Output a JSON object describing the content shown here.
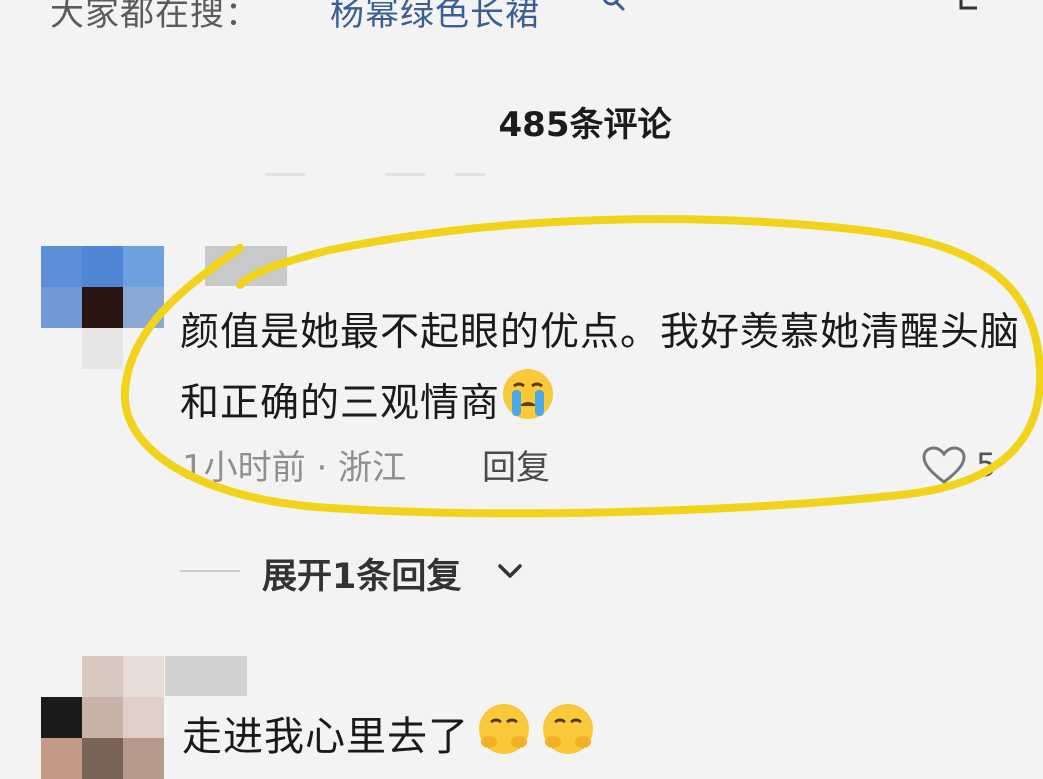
{
  "search": {
    "prefix": "大家都在搜：",
    "term": "杨幂绿色长裙"
  },
  "comments_header": {
    "count_label": "485条评论"
  },
  "comment1": {
    "text": "颜值是她最不起眼的优点。我好羡慕她清醒头脑和正确的三观情商",
    "emoji": "loudly-crying-face",
    "meta": "1小时前 · 浙江",
    "reply_label": "回复",
    "likes": "5"
  },
  "replies": {
    "expand_label": "展开1条回复"
  },
  "comment2": {
    "text": "走进我心里去了"
  },
  "colors": {
    "highlight": "#f2d31b",
    "search_term": "#3b5f93"
  }
}
